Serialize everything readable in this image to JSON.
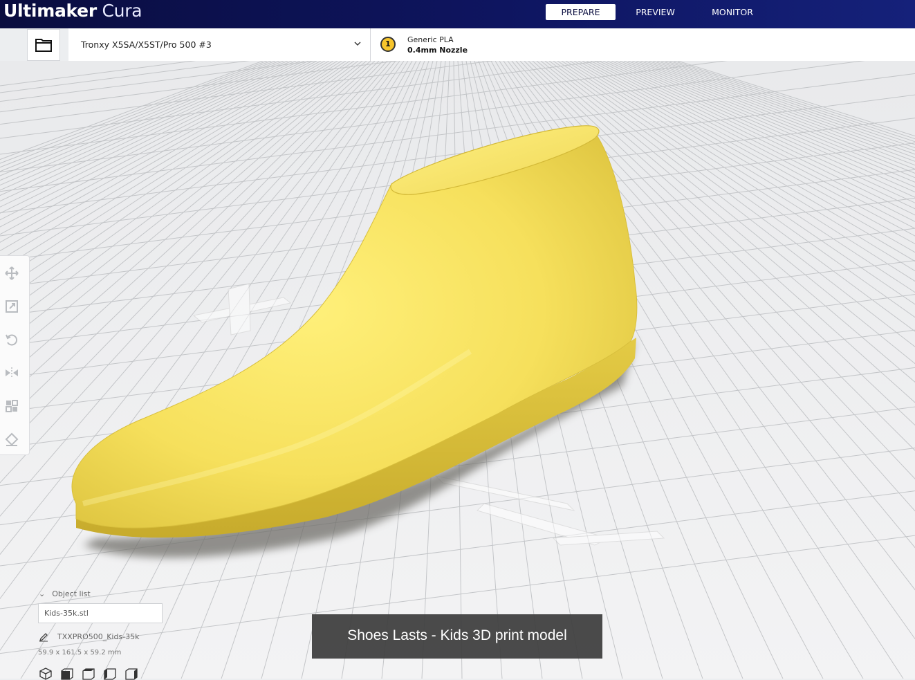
{
  "app": {
    "title_bold": "Ultimaker",
    "title_light": "Cura"
  },
  "stages": [
    {
      "label": "PREPARE",
      "active": true
    },
    {
      "label": "PREVIEW",
      "active": false
    },
    {
      "label": "MONITOR",
      "active": false
    }
  ],
  "printer": {
    "name": "Tronxy X5SA/X5ST/Pro 500 #3"
  },
  "extruder": {
    "number": "1",
    "material": "Generic PLA",
    "nozzle": "0.4mm Nozzle",
    "color": "#f7c52c"
  },
  "tools": [
    "move-icon",
    "scale-icon",
    "rotate-icon",
    "mirror-icon",
    "per-model-settings-icon",
    "support-blocker-icon"
  ],
  "object_list": {
    "header": "Object list",
    "items": [
      "Kids-35k.stl"
    ],
    "job_name": "TXXPRO500_Kids-35k",
    "dimensions": "59.9 x 161.5 x 59.2 mm"
  },
  "view_icons": [
    "3d-view-icon",
    "front-view-icon",
    "top-view-icon",
    "left-view-icon",
    "right-view-icon"
  ],
  "model": {
    "color": "#f6e15f"
  },
  "caption": "Shoes Lasts - Kids 3D print model"
}
